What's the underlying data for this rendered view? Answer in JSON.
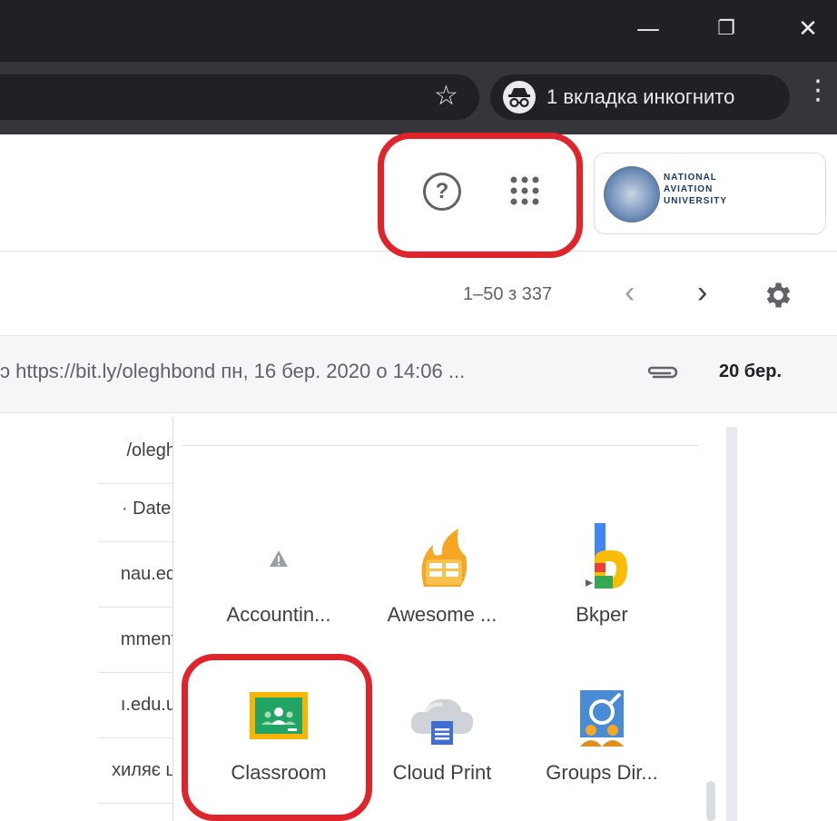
{
  "browser": {
    "window_controls": {
      "minimize": "—",
      "restore": "❐",
      "close": "✕"
    },
    "incognito_label": "1 вкладка инкогнито",
    "menu_icon": "⋮",
    "star_icon": "☆"
  },
  "gmail": {
    "help_icon": "?",
    "account_logo_text": [
      "NATIONAL",
      "AVIATION",
      "UNIVERSITY"
    ],
    "pagination": "1–50 з 337",
    "prev_icon": "‹",
    "next_icon": "›",
    "mail_row": {
      "snippet": "ɔ https://bit.ly/oleghbond пн, 16 бер. 2020 о 14:06 ...",
      "date": "20 бер."
    }
  },
  "left_fragments": [
    "/olegh",
    "· Date:",
    "nau.ed",
    "mment",
    "ı.edu.u",
    "хиляє ц"
  ],
  "apps": [
    {
      "label": "Accountin...",
      "icon": "warning-icon"
    },
    {
      "label": "Awesome ...",
      "icon": "awesome-table-icon"
    },
    {
      "label": "Bkper",
      "icon": "bkper-icon"
    },
    {
      "label": "Classroom",
      "icon": "classroom-icon"
    },
    {
      "label": "Cloud Print",
      "icon": "cloud-print-icon"
    },
    {
      "label": "Groups Dir...",
      "icon": "groups-directory-icon"
    }
  ],
  "colors": {
    "highlight": "#e0242c",
    "chrome_dark": "#202124",
    "chrome_toolbar": "#35363a"
  }
}
